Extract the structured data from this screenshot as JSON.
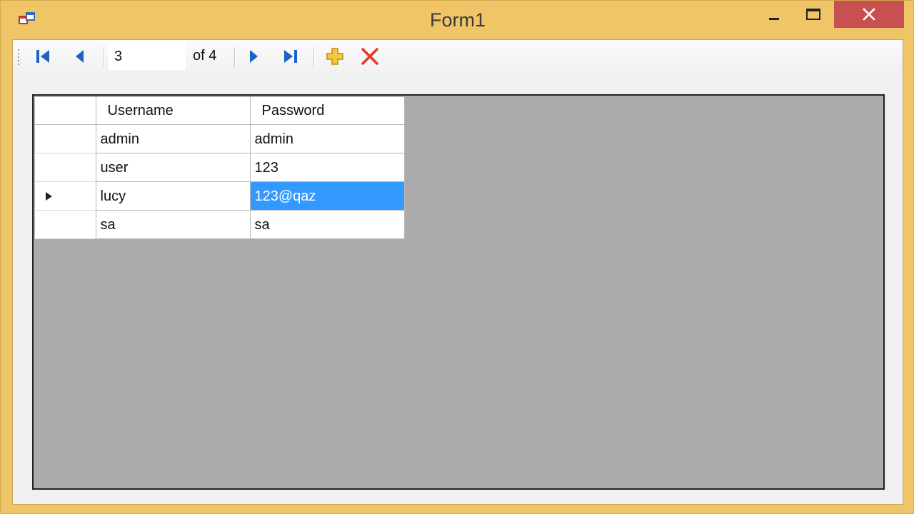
{
  "window": {
    "title": "Form1",
    "controls": {
      "minimize": "minimize",
      "maximize": "maximize",
      "close": "close"
    }
  },
  "toolbar": {
    "position_value": "3",
    "count_label": "of 4",
    "buttons": [
      "move-first",
      "move-previous",
      "move-next",
      "move-last",
      "add-new",
      "delete"
    ]
  },
  "grid": {
    "columns": [
      "Username",
      "Password"
    ],
    "rows": [
      {
        "username": "admin",
        "password": "admin"
      },
      {
        "username": "user",
        "password": "123"
      },
      {
        "username": "lucy",
        "password": "123@qaz",
        "current": true
      },
      {
        "username": "sa",
        "password": "sa"
      }
    ]
  },
  "colors": {
    "frame": "#f0c567",
    "close_button": "#c75050",
    "selection": "#3399ff",
    "grid_background": "#ababab",
    "nav_icon": "#1e62c8",
    "add_icon": "#e8b423",
    "delete_icon": "#e53a2a"
  }
}
